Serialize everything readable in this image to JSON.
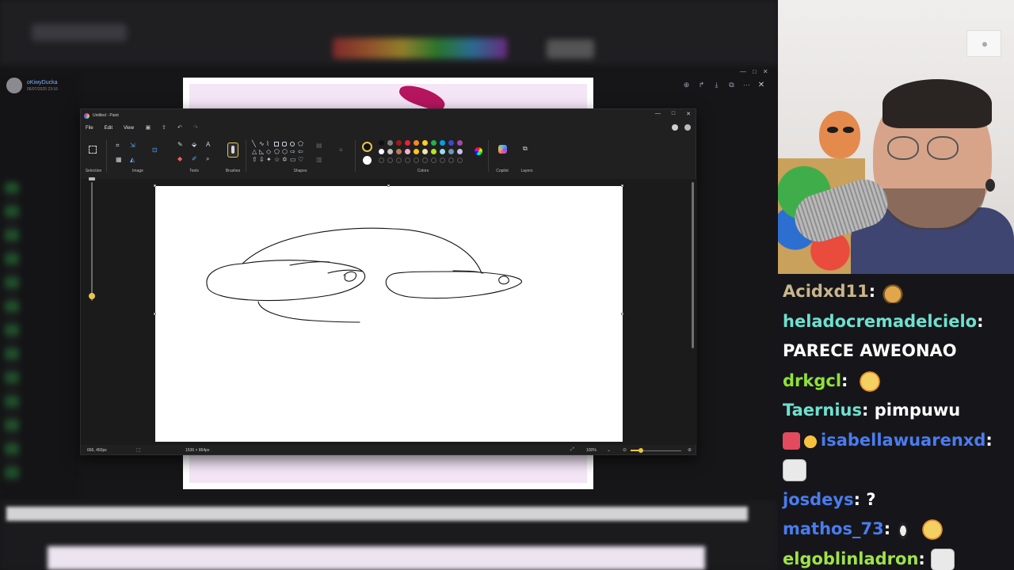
{
  "viewer": {
    "username": "oKiwyDucka",
    "date": "06/07/2025 23:16"
  },
  "paint": {
    "window_title": "Untitled - Paint",
    "menu": [
      "File",
      "Edit",
      "View"
    ],
    "ribbon_groups": [
      "Selection",
      "Image",
      "Tools",
      "Brushes",
      "Shapes",
      "Colors",
      "Copilot",
      "Layers"
    ],
    "colors": {
      "primary": "#111111",
      "secondary": "#ffffff",
      "palette_row1": [
        "#111111",
        "#7f7f7f",
        "#a01a1a",
        "#e8223a",
        "#f58a1e",
        "#f5d31e",
        "#23b14c",
        "#00a2e8",
        "#3f48cc",
        "#a349a4"
      ],
      "palette_row2": [
        "#ffffff",
        "#c3c3c3",
        "#b97a57",
        "#ffaec9",
        "#ffc90e",
        "#efe4b0",
        "#b5e61d",
        "#99d9ea",
        "#7092be",
        "#c8bfe7"
      ]
    },
    "status": {
      "cursor": "666, 450px",
      "canvas_size": "1536 × 864px",
      "zoom": "100%"
    }
  },
  "chat": {
    "messages": [
      {
        "user": "Acidxd11",
        "color": "#c9b78c",
        "text": "",
        "emotes": [
          "crab"
        ]
      },
      {
        "user": "heladocremadelcielo",
        "color": "#6fe0cf",
        "text": "PARECE AWEONAO",
        "emotes": []
      },
      {
        "user": "drkgcl",
        "color": "#8fe13a",
        "text": "",
        "emotes": [
          "cry"
        ]
      },
      {
        "user": "Taernius",
        "color": "#6fe0cf",
        "text": "pimpuwu",
        "emotes": []
      },
      {
        "user": "isabellawuarenxd",
        "color": "#4a7cf0",
        "text": "",
        "emotes": [
          "cat"
        ],
        "badges": [
          "pen",
          "glasses"
        ]
      },
      {
        "user": "josdeys",
        "color": "#4a7cf0",
        "text": "?",
        "emotes": []
      },
      {
        "user": "mathos_73",
        "color": "#4a7cf0",
        "text": "",
        "emotes": [
          "penguin",
          "cry"
        ]
      },
      {
        "user": "elgoblinladron",
        "color": "#9fe24a",
        "text": "",
        "emotes": [
          "cat"
        ]
      }
    ]
  }
}
